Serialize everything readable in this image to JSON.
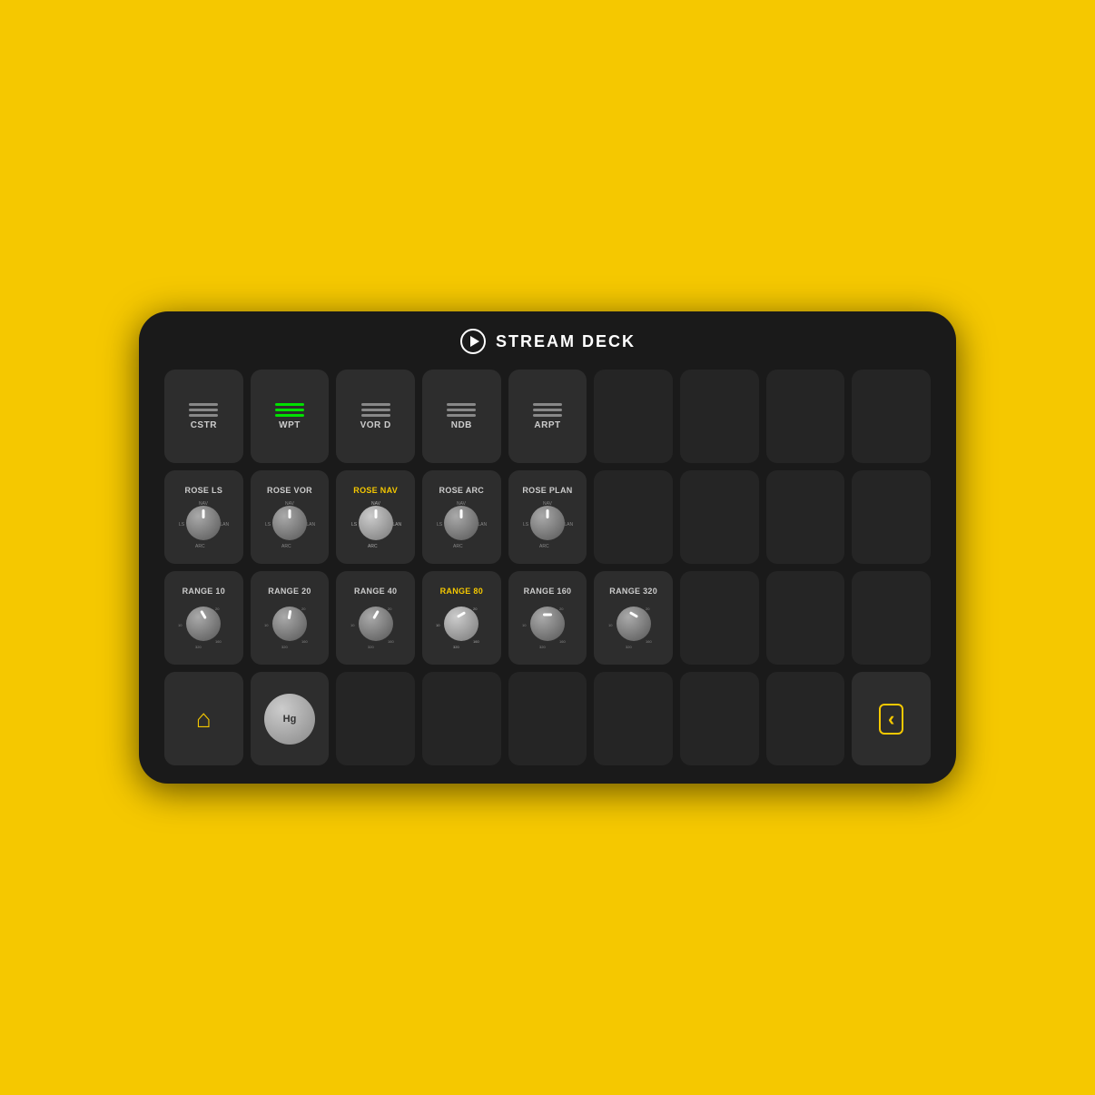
{
  "device": {
    "title": "STREAM DECK",
    "background": "#1a1a1a"
  },
  "row1": {
    "buttons": [
      {
        "id": "cstr",
        "label": "CSTR",
        "type": "menu",
        "active": false
      },
      {
        "id": "wpt",
        "label": "WPT",
        "type": "menu",
        "active": true
      },
      {
        "id": "vord",
        "label": "VOR D",
        "type": "menu",
        "active": false
      },
      {
        "id": "ndb",
        "label": "NDB",
        "type": "menu",
        "active": false
      },
      {
        "id": "arpt",
        "label": "ARPT",
        "type": "menu",
        "active": false
      }
    ]
  },
  "row2": {
    "buttons": [
      {
        "id": "rosels",
        "label": "ROSE LS",
        "type": "knob",
        "highlight": false
      },
      {
        "id": "rosevOR",
        "label": "ROSE VOR",
        "type": "knob",
        "highlight": false
      },
      {
        "id": "rosenav",
        "label": "ROSE NAV",
        "type": "knob",
        "highlight": true
      },
      {
        "id": "rosearc",
        "label": "ROSE ARC",
        "type": "knob",
        "highlight": false
      },
      {
        "id": "roseplan",
        "label": "ROSE PLAN",
        "type": "knob",
        "highlight": false
      }
    ]
  },
  "row3": {
    "buttons": [
      {
        "id": "range10",
        "label": "RANGE 10",
        "type": "range-knob",
        "highlight": false
      },
      {
        "id": "range20",
        "label": "RANGE 20",
        "type": "range-knob",
        "highlight": false
      },
      {
        "id": "range40",
        "label": "RANGE 40",
        "type": "range-knob",
        "highlight": false
      },
      {
        "id": "range80",
        "label": "RANGE 80",
        "type": "range-knob",
        "highlight": true
      },
      {
        "id": "range160",
        "label": "RANGE 160",
        "type": "range-knob",
        "highlight": false
      },
      {
        "id": "range320",
        "label": "RANGE 320",
        "type": "range-knob",
        "highlight": false
      }
    ]
  },
  "row4": {
    "home_label": "home",
    "back_label": "‹",
    "hg_label": "Hg"
  },
  "colors": {
    "yellow": "#F5C800",
    "active_green": "#00e000",
    "device_bg": "#1a1a1a"
  }
}
